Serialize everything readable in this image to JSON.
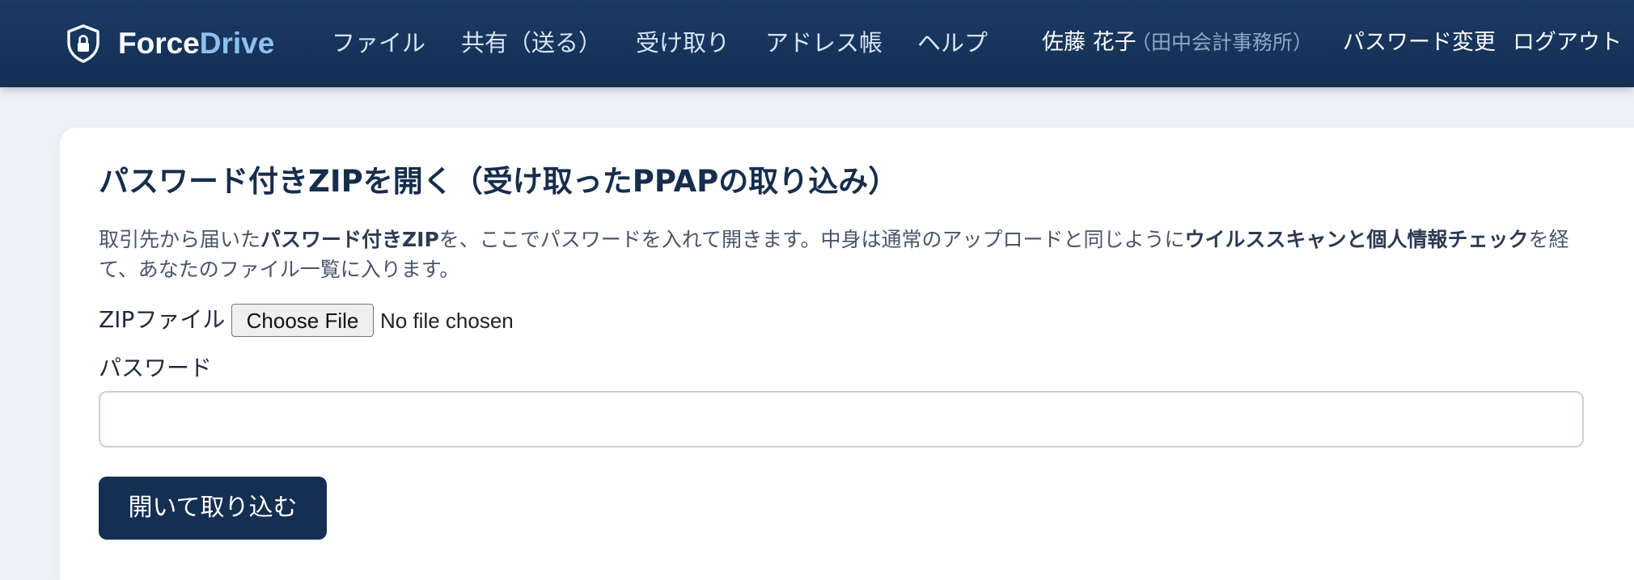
{
  "brand": {
    "name_part1": "Force",
    "name_part2": "Drive",
    "icon": "shield-lock-icon",
    "colors": {
      "primary": "#ffffff",
      "accent": "#8cc0ef"
    }
  },
  "nav": {
    "files": "ファイル",
    "share": "共有（送る）",
    "receive": "受け取り",
    "address_book": "アドレス帳",
    "help": "ヘルプ"
  },
  "user": {
    "name": "佐藤 花子",
    "org": "（田中会計事務所）",
    "change_password": "パスワード変更",
    "logout": "ログアウト"
  },
  "page": {
    "title": "パスワード付きZIPを開く（受け取ったPPAPの取り込み）",
    "desc_part1": "取引先から届いた",
    "desc_bold1": "パスワード付きZIP",
    "desc_part2": "を、ここでパスワードを入れて開きます。中身は通常のアップロードと同じように",
    "desc_bold2": "ウイルススキャンと個人情報チェック",
    "desc_part3": "を経て、あなたのファイル一覧に入ります。"
  },
  "form": {
    "zip_label": "ZIPファイル",
    "choose_file": "Choose File",
    "no_file": "No file chosen",
    "password_label": "パスワード",
    "password_value": "",
    "submit": "開いて取り込む"
  },
  "colors": {
    "header_bg": "#1b3a64",
    "page_bg": "#eef1f6",
    "button_bg": "#152f52"
  }
}
